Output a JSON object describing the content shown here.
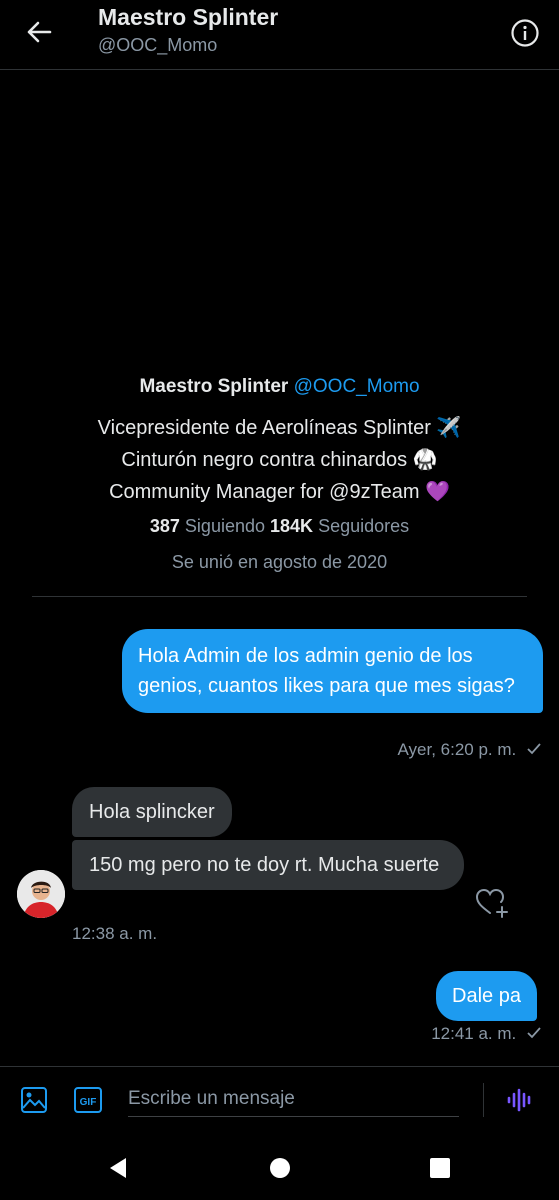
{
  "header": {
    "title": "Maestro Splinter",
    "handle": "@OOC_Momo"
  },
  "profile": {
    "name": "Maestro Splinter",
    "handle": "@OOC_Momo",
    "bio": [
      "Vicepresidente de Aerolíneas Splinter ✈️",
      "Cinturón negro contra chinardos 🥋",
      "Community Manager for @9zTeam 💜"
    ],
    "following_count": "387",
    "following_label": "Siguiendo",
    "followers_count": "184K",
    "followers_label": "Seguidores",
    "joined": "Se unió en agosto de 2020"
  },
  "messages": [
    {
      "text": "Hola Admin de los admin genio de los genios, cuantos likes para que mes sigas?",
      "time": "Ayer, 6:20 p. m."
    },
    {
      "text": "Hola splincker"
    },
    {
      "text": "150 mg pero no te doy rt. Mucha suerte",
      "time": "12:38 a. m."
    },
    {
      "text": "Dale pa",
      "time": "12:41 a. m."
    }
  ],
  "composer": {
    "placeholder": "Escribe un mensaje",
    "gif_label": "GIF"
  },
  "colors": {
    "accent": "#1d9bf0",
    "voice": "#7856ff",
    "bubble_in": "#2f3336",
    "muted_text": "#8b98a5"
  }
}
